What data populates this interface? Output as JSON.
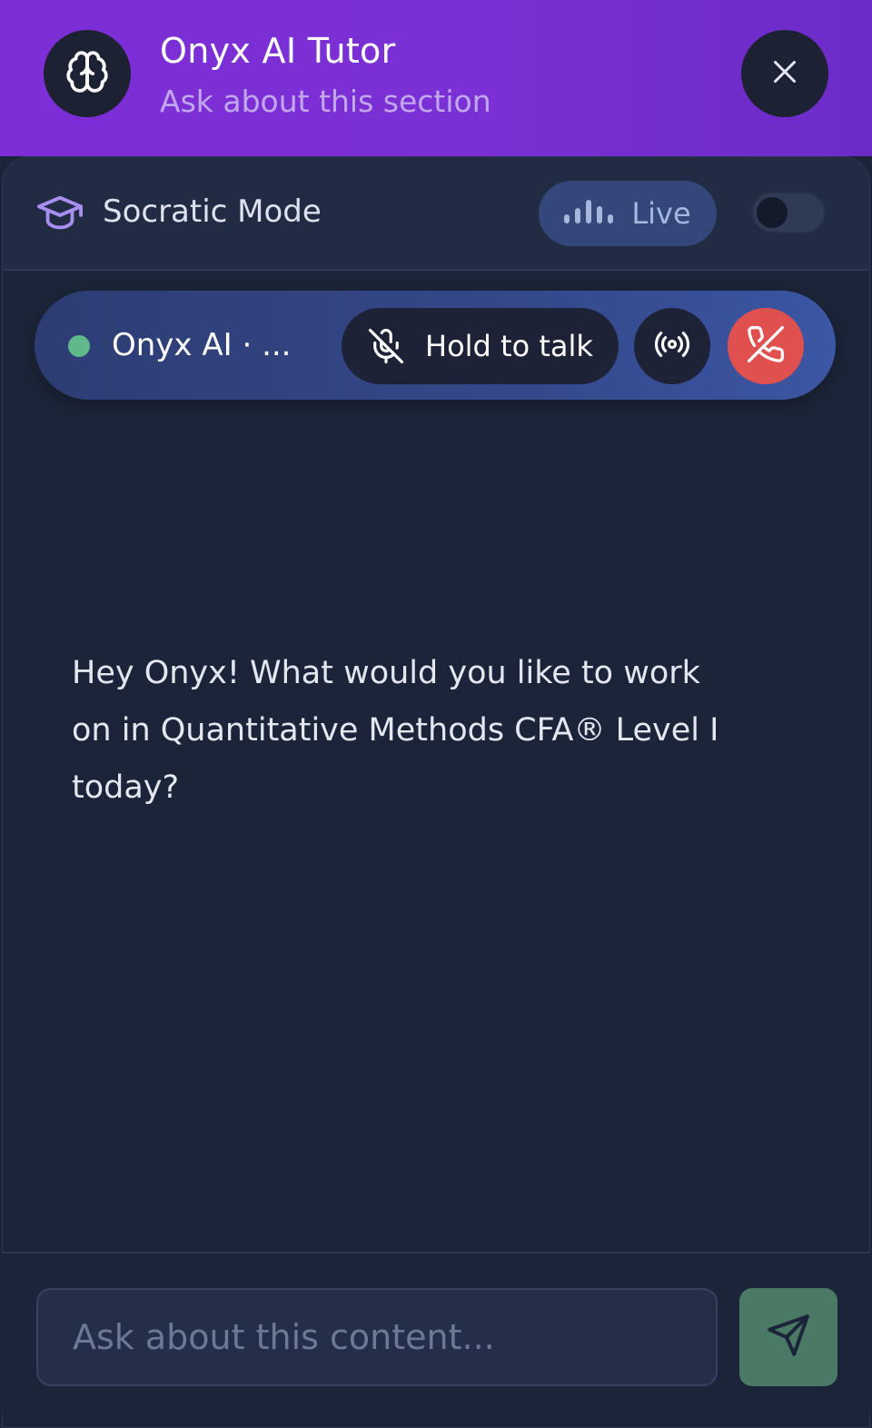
{
  "header": {
    "title": "Onyx AI Tutor",
    "subtitle": "Ask about this section",
    "avatar_icon": "brain-icon",
    "close_icon": "close-icon"
  },
  "mode_bar": {
    "icon": "graduation-cap-icon",
    "label": "Socratic Mode",
    "live_label": "Live",
    "live_icon": "audio-bars-icon",
    "toggle_on": false
  },
  "call_bar": {
    "status": "online",
    "status_color": "#5fb98a",
    "name": "Onyx AI · ...",
    "hold_to_talk_label": "Hold to talk",
    "mic_icon": "mic-off-icon",
    "broadcast_icon": "broadcast-icon",
    "hangup_icon": "phone-off-icon"
  },
  "chat": {
    "messages": [
      {
        "text": "Hey Onyx! What would you like to work on in Quantitative Methods CFA® Level I today?"
      }
    ]
  },
  "composer": {
    "placeholder": "Ask about this content...",
    "value": "",
    "send_icon": "send-icon"
  },
  "colors": {
    "header_gradient_start": "#7d2ed6",
    "header_gradient_end": "#6c2bc7",
    "accent_purple": "#a98ff0",
    "hangup_red": "#e0504e",
    "send_green": "#4a7a66",
    "background": "#1b2338"
  }
}
